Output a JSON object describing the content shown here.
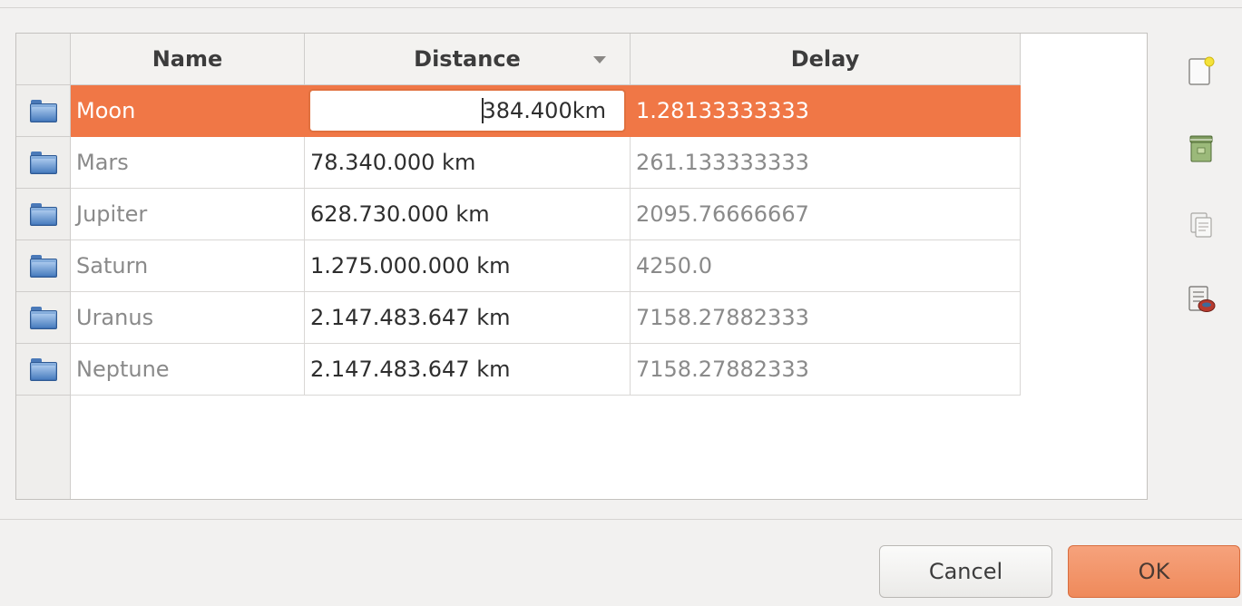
{
  "table": {
    "columns": {
      "name": "Name",
      "distance": "Distance",
      "delay": "Delay"
    },
    "rows": [
      {
        "name": "Moon",
        "distance": "384.400km",
        "delay": "1.28133333333",
        "selected": true,
        "editing": true
      },
      {
        "name": "Mars",
        "distance": "78.340.000 km",
        "delay": "261.133333333"
      },
      {
        "name": "Jupiter",
        "distance": "628.730.000 km",
        "delay": "2095.76666667"
      },
      {
        "name": "Saturn",
        "distance": "1.275.000.000 km",
        "delay": "4250.0"
      },
      {
        "name": "Uranus",
        "distance": "2.147.483.647 km",
        "delay": "7158.27882333"
      },
      {
        "name": "Neptune",
        "distance": "2.147.483.647 km",
        "delay": "7158.27882333"
      }
    ],
    "row_icon": "folder-icon",
    "sorted_column": "distance"
  },
  "toolbar": {
    "icons": [
      "new-item-icon",
      "remove-item-icon",
      "duplicate-icon",
      "properties-icon"
    ]
  },
  "buttons": {
    "cancel_label": "Cancel",
    "ok_label": "OK"
  },
  "colors": {
    "selection": "#f07746",
    "ok_button": "#ef8a5b"
  }
}
